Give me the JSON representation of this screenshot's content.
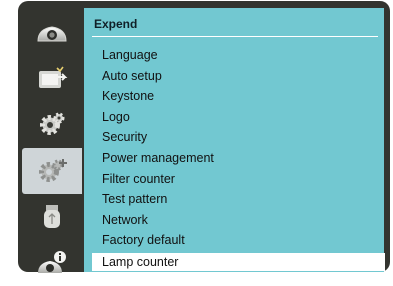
{
  "sidebar": {
    "items": [
      {
        "icon": "display-icon"
      },
      {
        "icon": "input-icon"
      },
      {
        "icon": "setting-icon"
      },
      {
        "icon": "expand-icon",
        "selected": true
      },
      {
        "icon": "usb-memory-icon"
      },
      {
        "icon": "information-icon"
      }
    ]
  },
  "panel": {
    "title": "Expend",
    "items": [
      {
        "label": "Language"
      },
      {
        "label": "Auto setup"
      },
      {
        "label": "Keystone"
      },
      {
        "label": "Logo"
      },
      {
        "label": "Security"
      },
      {
        "label": "Power management"
      },
      {
        "label": "Filter counter"
      },
      {
        "label": "Test pattern"
      },
      {
        "label": "Network"
      },
      {
        "label": "Factory default"
      },
      {
        "label": "Lamp counter",
        "selected": true
      }
    ]
  },
  "colors": {
    "frame": "#33342f",
    "panel": "#72c8d1",
    "selected_row": "#ffffff",
    "selected_tab": "#cfd5d8"
  }
}
